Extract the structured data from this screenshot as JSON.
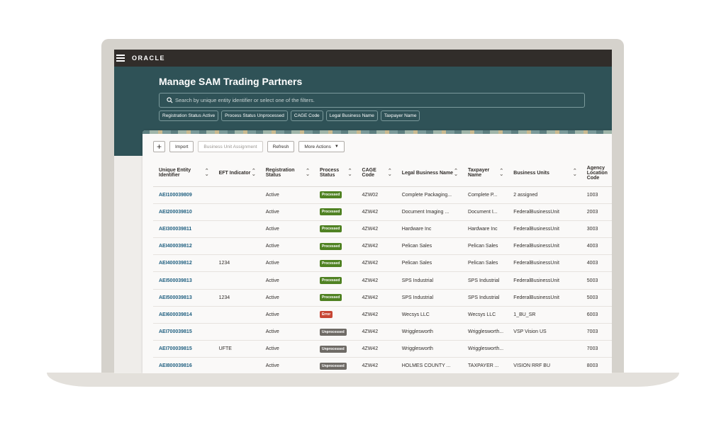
{
  "app": {
    "logo_text": "ORACLE"
  },
  "header": {
    "title": "Manage SAM Trading Partners",
    "search_placeholder": "Search by unique entity identifier or select one of the filters."
  },
  "filters": [
    "Registration Status Active",
    "Process Status Unprocessed",
    "CAGE Code",
    "Legal Business Name",
    "Taxpayer Name"
  ],
  "toolbar": {
    "add_label": "+",
    "import_label": "Import",
    "bu_assignment_label": "Business Unit Assignment",
    "refresh_label": "Refresh",
    "more_actions_label": "More Actions"
  },
  "table": {
    "columns": [
      {
        "label": "Unique Entity Identifier",
        "sortable": true
      },
      {
        "label": "EFT Indicator",
        "sortable": true
      },
      {
        "label": "Registration Status",
        "sortable": true
      },
      {
        "label": "Process Status",
        "sortable": true
      },
      {
        "label": "CAGE Code",
        "sortable": true
      },
      {
        "label": "Legal Business Name",
        "sortable": true
      },
      {
        "label": "Taxpayer Name",
        "sortable": true
      },
      {
        "label": "Business Units",
        "sortable": true
      },
      {
        "label": "Agency Location Code",
        "sortable": false
      }
    ],
    "rows": [
      {
        "id": "AEI100039809",
        "eft": "",
        "reg": "Active",
        "status": "Processed",
        "status_kind": "processed",
        "cage": "4ZW02",
        "legal": "Complete Packaging...",
        "taxpayer": "Complete P...",
        "bu": "2 assigned",
        "alc": "1003"
      },
      {
        "id": "AEI200039810",
        "eft": "",
        "reg": "Active",
        "status": "Processed",
        "status_kind": "processed",
        "cage": "4ZW42",
        "legal": "Document Imaging ...",
        "taxpayer": "Document I...",
        "bu": "FederalBusinessUnit",
        "alc": "2003"
      },
      {
        "id": "AEI300039811",
        "eft": "",
        "reg": "Active",
        "status": "Processed",
        "status_kind": "processed",
        "cage": "4ZW42",
        "legal": "Hardware Inc",
        "taxpayer": "Hardware Inc",
        "bu": "FederalBusinessUnit",
        "alc": "3003"
      },
      {
        "id": "AEI400039812",
        "eft": "",
        "reg": "Active",
        "status": "Processed",
        "status_kind": "processed",
        "cage": "4ZW42",
        "legal": "Pelican Sales",
        "taxpayer": "Pelican Sales",
        "bu": "FederalBusinessUnit",
        "alc": "4003"
      },
      {
        "id": "AEI400039812",
        "eft": "1234",
        "reg": "Active",
        "status": "Processed",
        "status_kind": "processed",
        "cage": "4ZW42",
        "legal": "Pelican Sales",
        "taxpayer": "Pelican Sales",
        "bu": "FederalBusinessUnit",
        "alc": "4003"
      },
      {
        "id": "AEI500039813",
        "eft": "",
        "reg": "Active",
        "status": "Processed",
        "status_kind": "processed",
        "cage": "4ZW42",
        "legal": "SPS Industrial",
        "taxpayer": "SPS Industrial",
        "bu": "FederalBusinessUnit",
        "alc": "5003"
      },
      {
        "id": "AEI500039813",
        "eft": "1234",
        "reg": "Active",
        "status": "Processed",
        "status_kind": "processed",
        "cage": "4ZW42",
        "legal": "SPS Industrial",
        "taxpayer": "SPS Industrial",
        "bu": "FederalBusinessUnit",
        "alc": "5003"
      },
      {
        "id": "AEI600039814",
        "eft": "",
        "reg": "Active",
        "status": "Error",
        "status_kind": "error",
        "cage": "4ZW42",
        "legal": "Wecsys LLC",
        "taxpayer": "Wecsys LLC",
        "bu": "1_BU_SR",
        "alc": "6003"
      },
      {
        "id": "AEI700039815",
        "eft": "",
        "reg": "Active",
        "status": "Unprocessed",
        "status_kind": "unprocessed",
        "cage": "4ZW42",
        "legal": "Wrigglesworth",
        "taxpayer": "Wrigglesworth...",
        "bu": "VSP Vision US",
        "alc": "7003"
      },
      {
        "id": "AEI700039815",
        "eft": "UFTE",
        "reg": "Active",
        "status": "Unprocessed",
        "status_kind": "unprocessed",
        "cage": "4ZW42",
        "legal": "Wrigglesworth",
        "taxpayer": "Wrigglesworth...",
        "bu": "",
        "alc": "7003"
      },
      {
        "id": "AEI800039816",
        "eft": "",
        "reg": "Active",
        "status": "Unprocessed",
        "status_kind": "unprocessed",
        "cage": "4ZW42",
        "legal": "HOLMES COUNTY ...",
        "taxpayer": "TAXPAYER ...",
        "bu": "VISION RRF BU",
        "alc": "8003"
      }
    ]
  },
  "colors": {
    "header_bg": "#2f5257",
    "topbar_bg": "#312d2a",
    "link": "#1f5f80",
    "processed": "#508223",
    "error": "#c74634",
    "unprocessed": "#6f6b66"
  }
}
